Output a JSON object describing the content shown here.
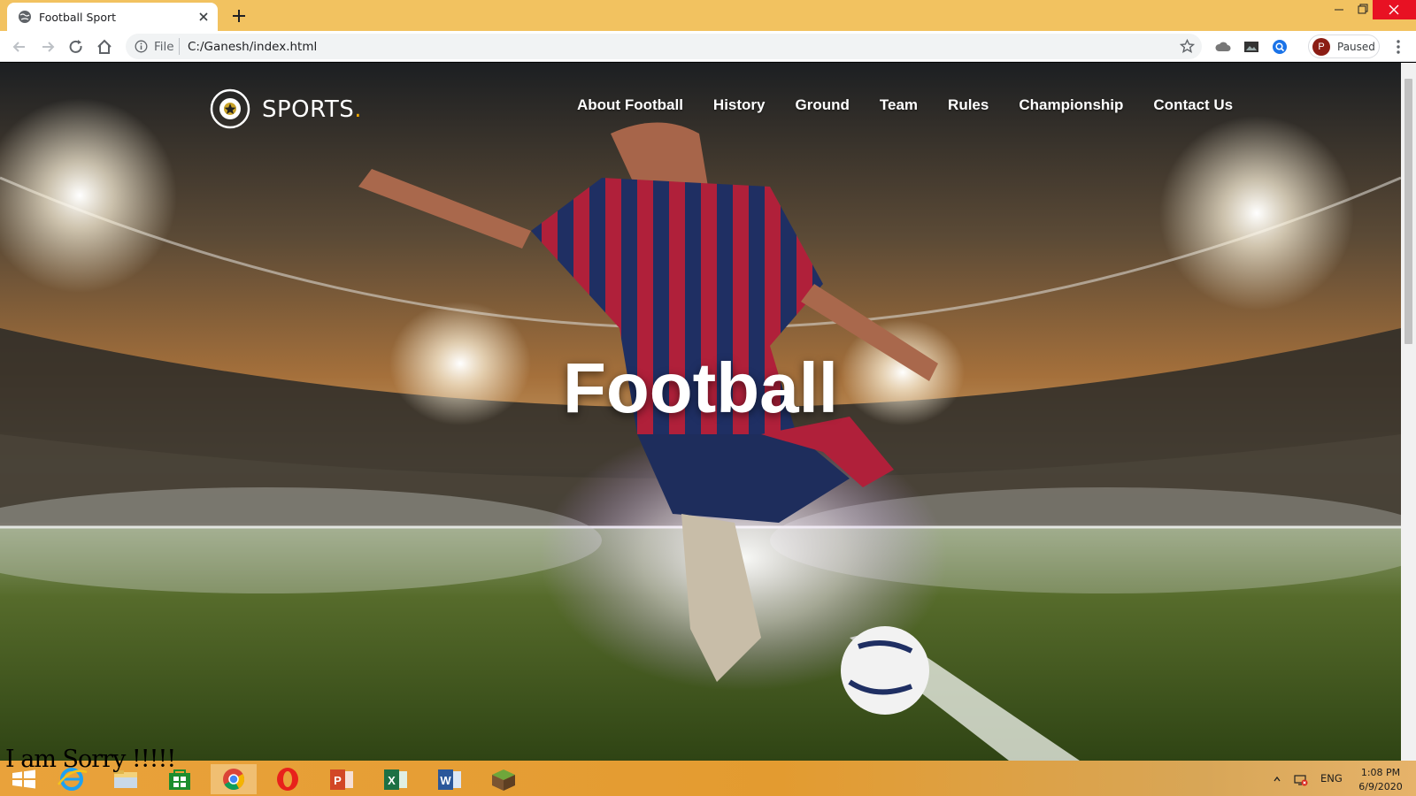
{
  "browser": {
    "tab_title": "Football Sport",
    "url_scheme": "File",
    "url_path": "C:/Ganesh/index.html",
    "profile_status": "Paused",
    "profile_initial": "P"
  },
  "site": {
    "brand": "SPORTS",
    "brand_dot": ".",
    "nav": [
      "About Football",
      "History",
      "Ground",
      "Team",
      "Rules",
      "Championship",
      "Contact Us"
    ],
    "hero_title": "Football"
  },
  "overlay_text": "I am Sorry !!!!!",
  "taskbar": {
    "apps": [
      "start-icon",
      "internet-explorer-icon",
      "file-explorer-icon",
      "store-icon",
      "chrome-icon",
      "opera-icon",
      "powerpoint-icon",
      "excel-icon",
      "word-icon",
      "minecraft-icon"
    ],
    "language": "ENG",
    "time": "1:08 PM",
    "date": "6/9/2020"
  },
  "colors": {
    "titlebar": "#f2c260",
    "close_button": "#e81123",
    "brand_accent": "#f2a900",
    "taskbar": "#e9a23b"
  }
}
